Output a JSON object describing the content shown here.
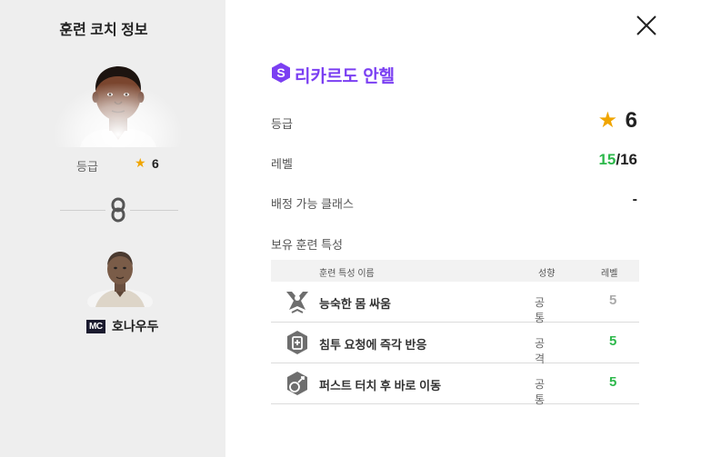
{
  "left_panel": {
    "title": "훈련 코치 정보",
    "grade_label": "등급",
    "grade_star": "★",
    "grade_value": "6",
    "position": "MC",
    "player_name": "호나우두"
  },
  "right_panel": {
    "coach_name": "리카르도 안헬",
    "rows": {
      "grade_label": "등급",
      "grade_star": "★",
      "grade_value": "6",
      "level_label": "레벨",
      "level_current": "15",
      "level_max": "/16",
      "class_label": "배정 가능 클래스",
      "class_value": "-",
      "traits_label": "보유 훈련 특성"
    },
    "table": {
      "headers": {
        "name": "훈련 특성 이름",
        "trait": "성향",
        "level": "레벨"
      },
      "rows": [
        {
          "icon": "muscle-trait-icon",
          "name": "능숙한 몸 싸움",
          "trait": "공통",
          "level": "5",
          "level_color": "#aaaaaa"
        },
        {
          "icon": "whistle-trait-icon",
          "name": "침투 요청에 즉각 반응",
          "trait": "공격",
          "level": "5",
          "level_color": "#2db84b"
        },
        {
          "icon": "ball-touch-trait-icon",
          "name": "퍼스트 터치 후 바로 이동",
          "trait": "공통",
          "level": "5",
          "level_color": "#2db84b"
        }
      ]
    }
  },
  "colors": {
    "accent": "#7b3ff2",
    "star": "#f0a500",
    "green": "#2db84b",
    "left_bg": "#eeeeee"
  }
}
